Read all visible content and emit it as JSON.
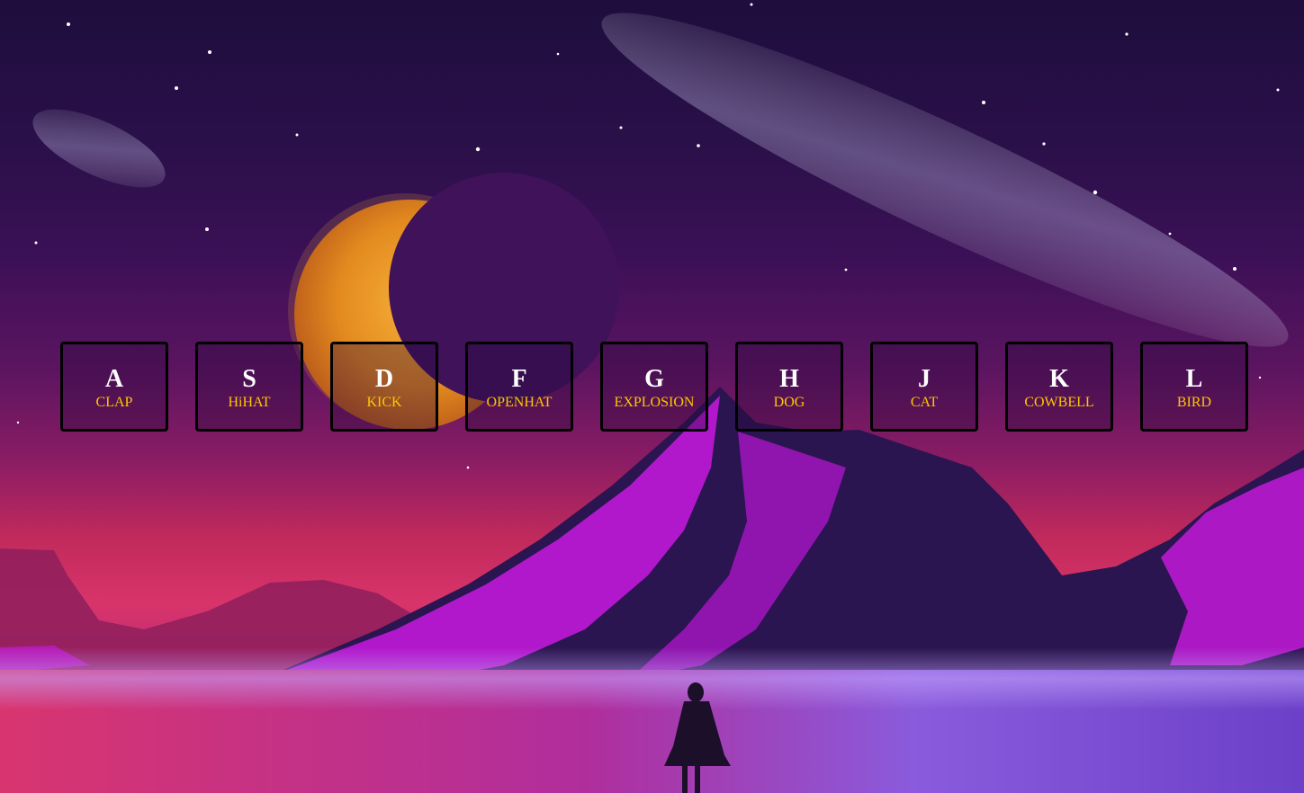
{
  "colors": {
    "key_letter": "#ffffff",
    "key_sound": "#ffc600",
    "key_border": "#000000"
  },
  "drum_kit": {
    "keys": [
      {
        "letter": "A",
        "sound": "CLAP"
      },
      {
        "letter": "S",
        "sound": "HiHAT"
      },
      {
        "letter": "D",
        "sound": "KICK"
      },
      {
        "letter": "F",
        "sound": "OPENHAT"
      },
      {
        "letter": "G",
        "sound": "EXPLOSION"
      },
      {
        "letter": "H",
        "sound": "DOG"
      },
      {
        "letter": "J",
        "sound": "CAT"
      },
      {
        "letter": "K",
        "sound": "COWBELL"
      },
      {
        "letter": "L",
        "sound": "BIRD"
      }
    ]
  }
}
